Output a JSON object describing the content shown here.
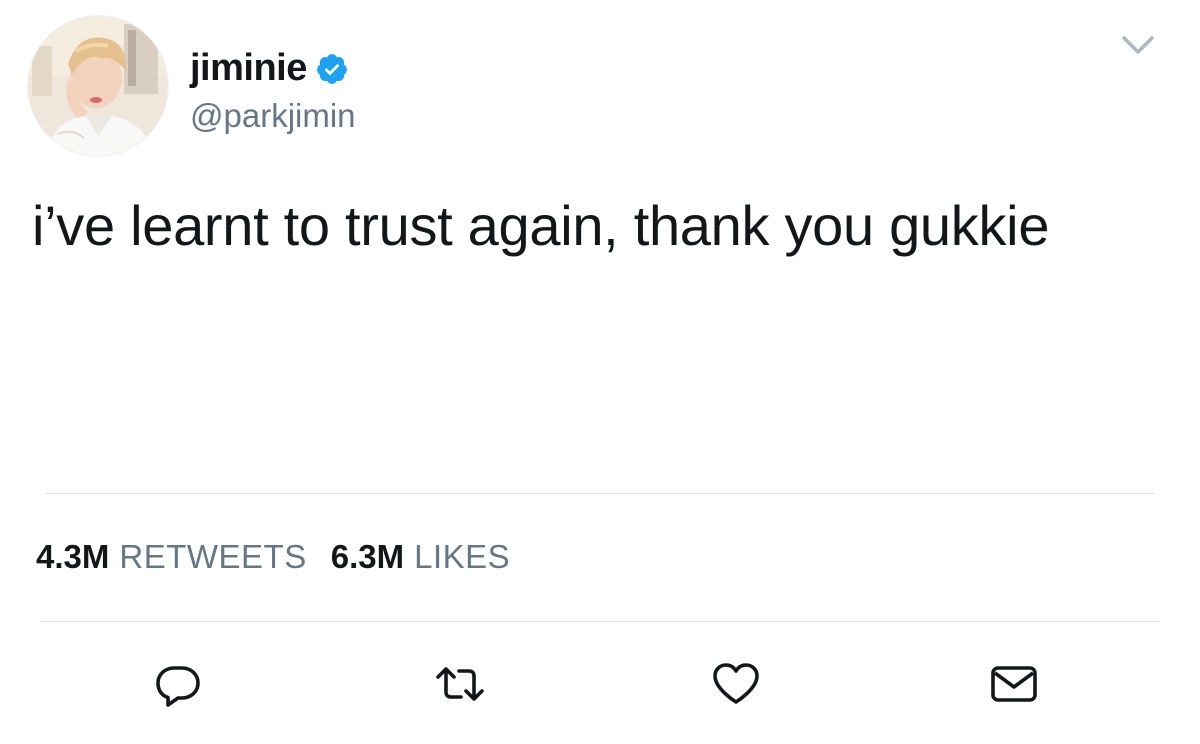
{
  "user": {
    "display_name": "jiminie",
    "handle": "@parkjimin",
    "verified": true
  },
  "tweet": {
    "text": "i’ve learnt to trust again, thank you gukkie"
  },
  "stats": {
    "retweets_count": "4.3M",
    "retweets_label": "RETWEETS",
    "likes_count": "6.3M",
    "likes_label": "LIKES"
  },
  "actions": [
    {
      "icon": "reply-icon"
    },
    {
      "icon": "retweet-icon"
    },
    {
      "icon": "like-icon"
    },
    {
      "icon": "direct-message-icon"
    }
  ],
  "colors": {
    "text_primary": "#14171a",
    "text_secondary": "#657786",
    "verified_blue": "#1da1f2",
    "divider": "#d9dfe3"
  }
}
